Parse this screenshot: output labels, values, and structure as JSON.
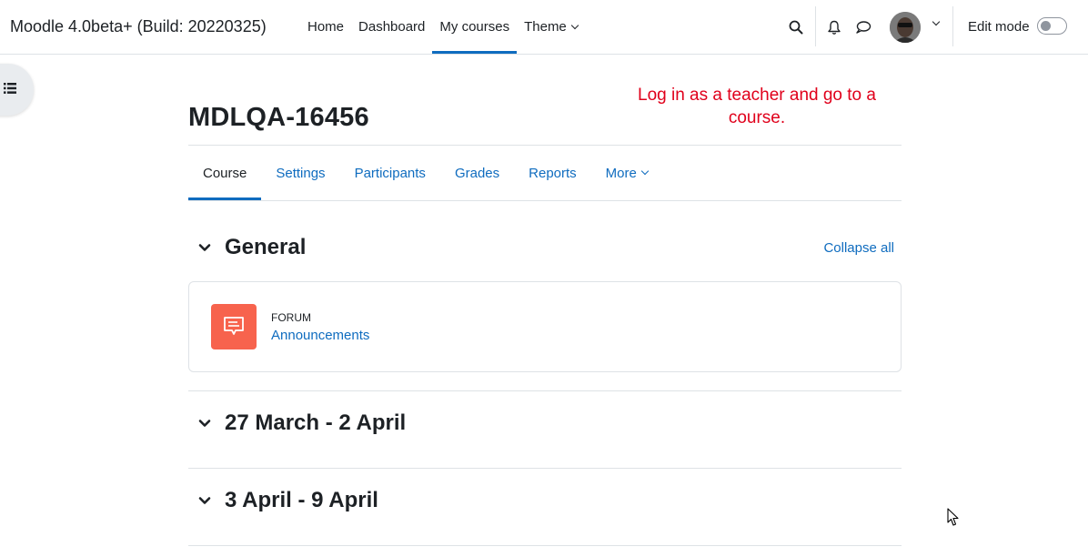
{
  "site": {
    "brand": "Moodle 4.0beta+ (Build: 20220325)"
  },
  "primary_nav": [
    {
      "label": "Home"
    },
    {
      "label": "Dashboard"
    },
    {
      "label": "My courses",
      "active": true
    },
    {
      "label": "Theme",
      "dropdown": true
    }
  ],
  "user_menu": {
    "icons": [
      "search-icon",
      "bell-icon",
      "message-icon"
    ],
    "edit_mode_label": "Edit mode",
    "edit_mode_on": false
  },
  "annotation": "Log in as a teacher and go to a course.",
  "course": {
    "title": "MDLQA-16456",
    "tabs": [
      {
        "label": "Course",
        "active": true
      },
      {
        "label": "Settings"
      },
      {
        "label": "Participants"
      },
      {
        "label": "Grades"
      },
      {
        "label": "Reports"
      },
      {
        "label": "More",
        "dropdown": true
      }
    ],
    "collapse_all": "Collapse all",
    "sections": [
      {
        "title": "General",
        "activities": [
          {
            "type": "FORUM",
            "name": "Announcements",
            "icon": "forum-icon"
          }
        ]
      },
      {
        "title": "27 March - 2 April"
      },
      {
        "title": "3 April - 9 April"
      }
    ]
  },
  "colors": {
    "link": "#0f6cbf",
    "text": "#1d2125",
    "annotation": "#e0001b",
    "forum_icon_bg": "#f7634d",
    "border": "#dee2e6"
  }
}
